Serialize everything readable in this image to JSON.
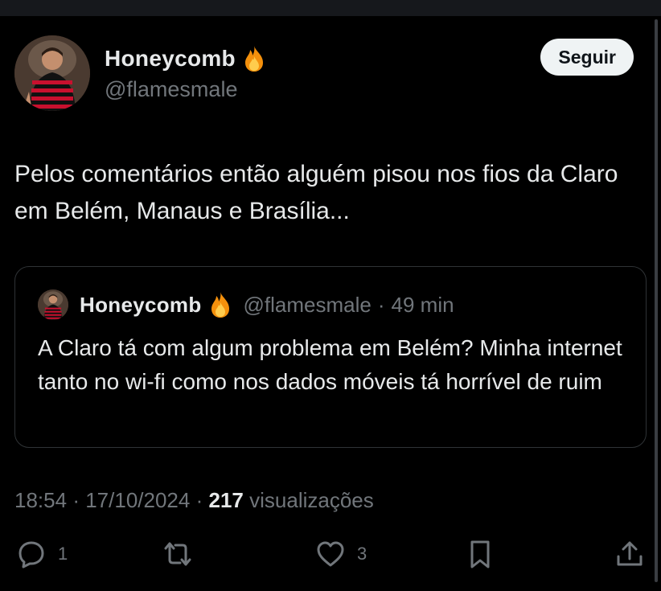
{
  "user": {
    "name": "Honeycomb",
    "handle": "@flamesmale",
    "avatar_icon": "avatar-player-red-black-jersey"
  },
  "follow_button": {
    "label": "Seguir"
  },
  "tweet": {
    "text": "Pelos comentários então alguém pisou nos fios da Claro em Belém, Manaus e Brasília..."
  },
  "quote": {
    "name": "Honeycomb",
    "handle": "@flamesmale",
    "separator": "·",
    "time": "49 min",
    "text": "A Claro tá com algum problema em Belém? Minha internet tanto no wi-fi como nos dados móveis tá horrível de ruim"
  },
  "meta": {
    "time": "18:54",
    "separator": "·",
    "date": "17/10/2024",
    "views": "217",
    "views_label": "visualizações"
  },
  "actions": {
    "replies": "1",
    "retweets": "",
    "likes": "3"
  },
  "colors": {
    "background": "#000000",
    "text": "#e7e9ea",
    "muted": "#71767b",
    "border": "#2f3336",
    "button_bg": "#eff3f4"
  }
}
